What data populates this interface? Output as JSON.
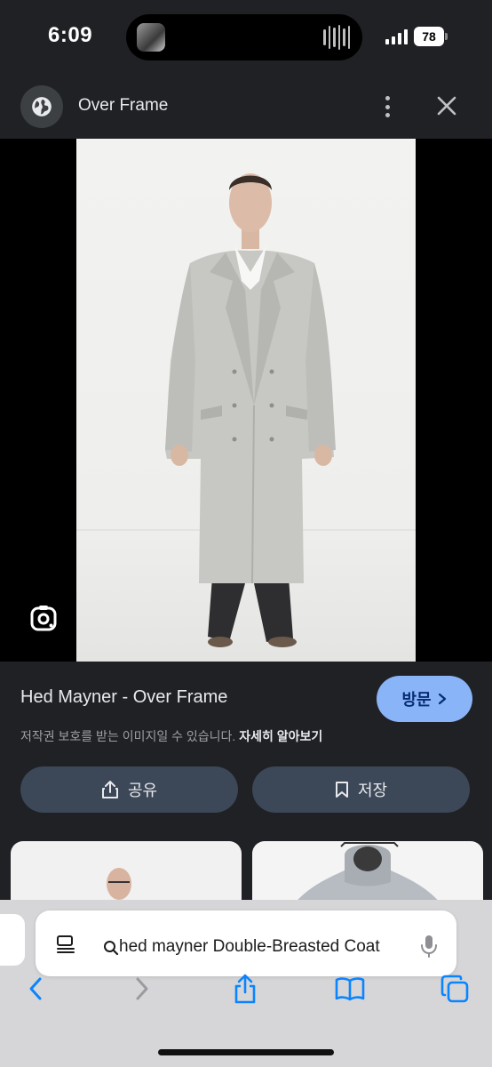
{
  "status_bar": {
    "time": "6:09",
    "battery": "78"
  },
  "header": {
    "site_name": "Over Frame",
    "icons": [
      "globe-icon",
      "more-vert-icon",
      "close-icon"
    ]
  },
  "viewer": {
    "icons": [
      "google-lens-icon"
    ]
  },
  "info": {
    "title": "Hed Mayner - Over Frame",
    "visit_label": "방문",
    "notice_text": "저작권 보호를 받는 이미지일 수 있습니다.",
    "notice_link": "자세히 알아보기",
    "share_label": "공유",
    "save_label": "저장"
  },
  "safari": {
    "url_text": "hed mayner Double-Breasted Coat",
    "icons": [
      "reader-icon",
      "search-icon",
      "mic-icon",
      "back-icon",
      "forward-icon",
      "share-icon",
      "bookmarks-icon",
      "tabs-icon"
    ]
  },
  "colors": {
    "background": "#202124",
    "accent": "#8ab4f8",
    "button": "#3c4758",
    "safari_bar": "#d6d6d8"
  }
}
